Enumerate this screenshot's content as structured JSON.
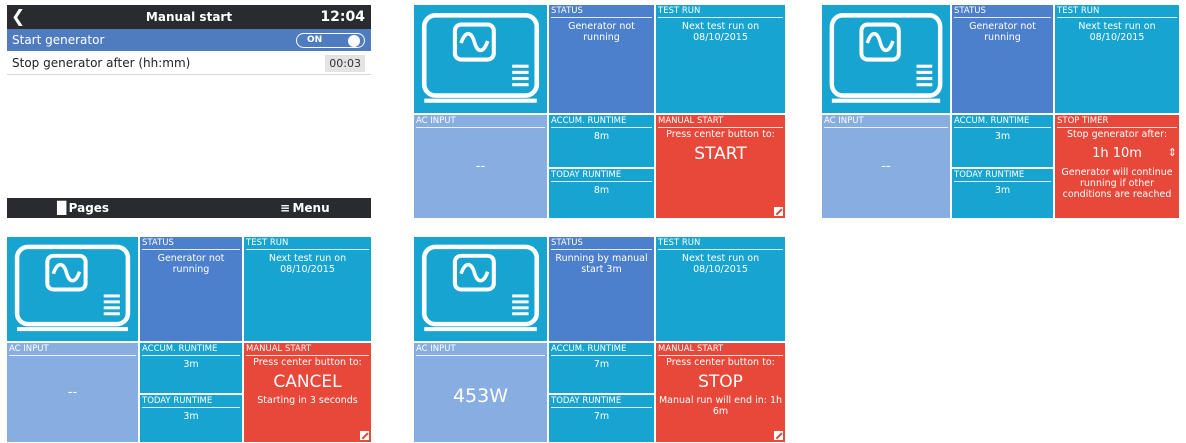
{
  "settings": {
    "title": "Manual start",
    "time": "12:04",
    "back_icon": "chevron-left-icon",
    "rows": [
      {
        "label": "Start generator",
        "toggle": "ON"
      },
      {
        "label": "Stop generator after (hh:mm)",
        "value": "00:03"
      }
    ],
    "footer": {
      "pages": "Pages",
      "menu": "Menu",
      "pages_icon": "bar-chart-icon",
      "menu_icon": "hamburger-icon"
    }
  },
  "panels": [
    {
      "status_header": "STATUS",
      "status_text": "Generator not running",
      "test_header": "TEST RUN",
      "test_text": "Next test run on 08/10/2015",
      "ac_header": "AC INPUT",
      "ac_value": "--",
      "accum_header": "ACCUM. RUNTIME",
      "accum_value": "8m",
      "today_header": "TODAY RUNTIME",
      "today_value": "8m",
      "action_header": "MANUAL START",
      "action_top": "Press center button to:",
      "action_big": "START",
      "action_bottom": ""
    },
    {
      "status_header": "STATUS",
      "status_text": "Generator not running",
      "test_header": "TEST RUN",
      "test_text": "Next test run on 08/10/2015",
      "ac_header": "AC INPUT",
      "ac_value": "--",
      "accum_header": "ACCUM. RUNTIME",
      "accum_value": "3m",
      "today_header": "TODAY RUNTIME",
      "today_value": "3m",
      "action_header": "STOP TIMER",
      "action_top": "Stop generator after:",
      "action_big": "1h 10m",
      "action_bottom": "Generator will continue running if other conditions are reached"
    },
    {
      "status_header": "STATUS",
      "status_text": "Generator not running",
      "test_header": "TEST RUN",
      "test_text": "Next test run on 08/10/2015",
      "ac_header": "AC INPUT",
      "ac_value": "--",
      "accum_header": "ACCUM. RUNTIME",
      "accum_value": "3m",
      "today_header": "TODAY RUNTIME",
      "today_value": "3m",
      "action_header": "MANUAL START",
      "action_top": "Press center button to:",
      "action_big": "CANCEL",
      "action_bottom": "Starting in 3 seconds"
    },
    {
      "status_header": "STATUS",
      "status_text": "Running by manual start 3m",
      "test_header": "TEST RUN",
      "test_text": "Next test run on 08/10/2015",
      "ac_header": "AC INPUT",
      "ac_value": "453W",
      "accum_header": "ACCUM. RUNTIME",
      "accum_value": "7m",
      "today_header": "TODAY RUNTIME",
      "today_value": "7m",
      "action_header": "MANUAL START",
      "action_top": "Press center button to:",
      "action_big": "STOP",
      "action_bottom": "Manual run will end in: 1h 6m"
    }
  ]
}
